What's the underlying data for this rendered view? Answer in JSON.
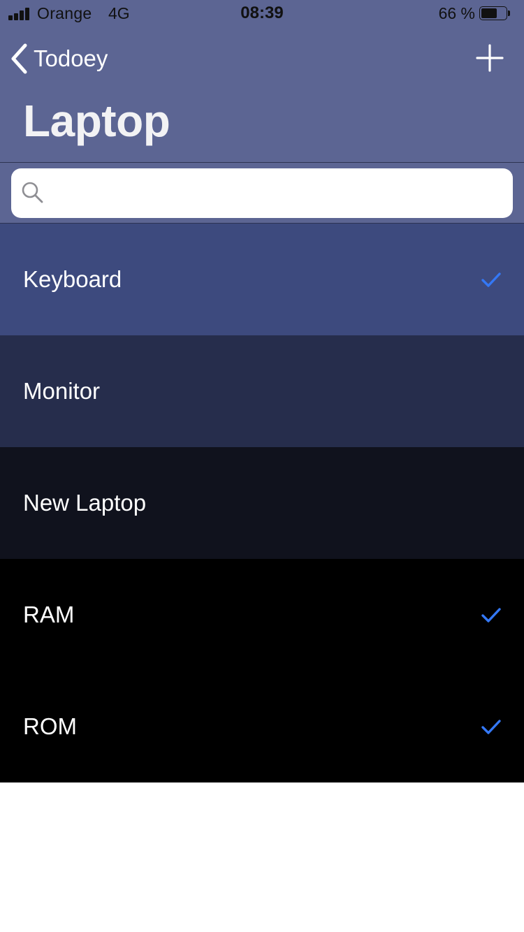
{
  "status_bar": {
    "carrier": "Orange",
    "network": "4G",
    "time": "08:39",
    "battery_percent": "66 %",
    "battery_level": 0.66
  },
  "nav": {
    "back_label": "Todoey",
    "title": "Laptop",
    "add_icon": "plus-icon",
    "back_icon": "chevron-left-icon"
  },
  "search": {
    "placeholder": "",
    "value": "",
    "icon": "search-icon"
  },
  "items": [
    {
      "label": "Keyboard",
      "done": true,
      "bg": "#3d4a7e"
    },
    {
      "label": "Monitor",
      "done": false,
      "bg": "#262d4c"
    },
    {
      "label": "New Laptop",
      "done": false,
      "bg": "#10121d"
    },
    {
      "label": "RAM",
      "done": true,
      "bg": "#000000"
    },
    {
      "label": "ROM",
      "done": true,
      "bg": "#000000"
    }
  ],
  "colors": {
    "nav_bar": "#5c6593",
    "checkmark": "#3478f6",
    "title_text": "#f2f2f4"
  }
}
